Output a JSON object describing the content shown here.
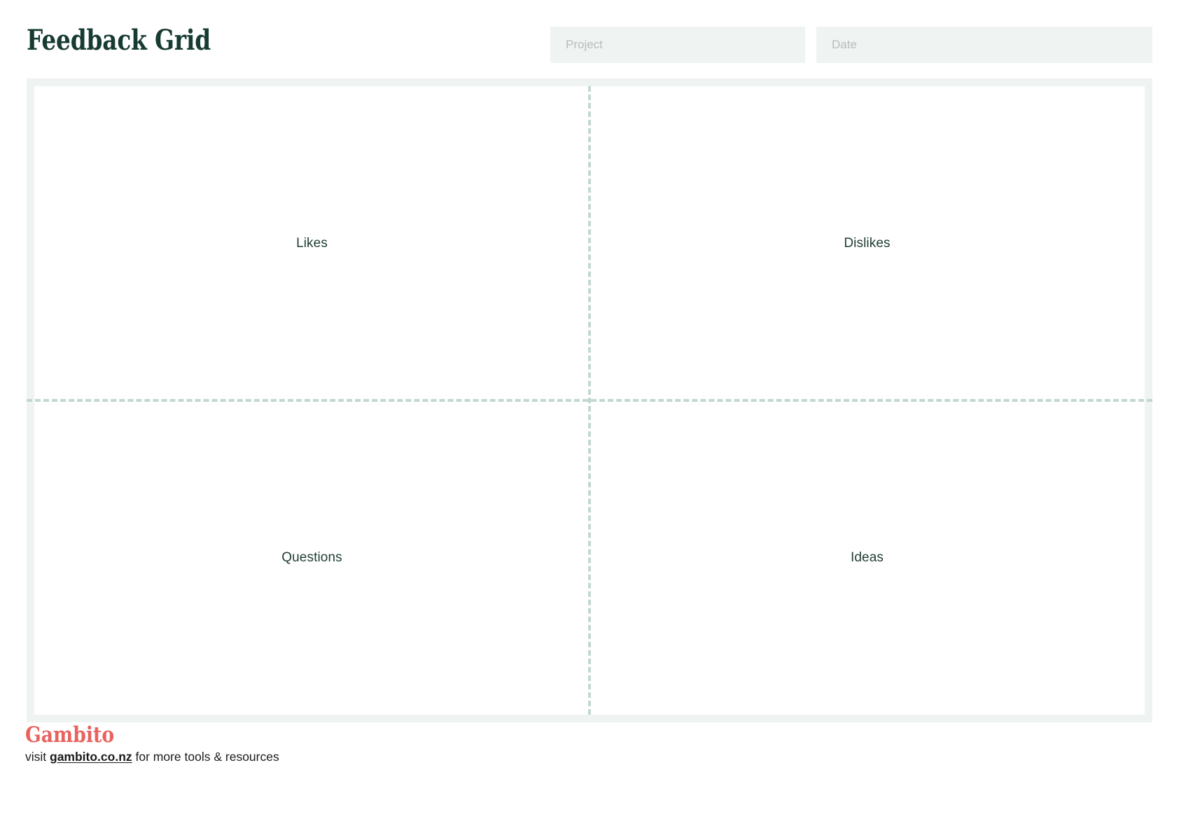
{
  "header": {
    "title": "Feedback Grid",
    "title_color": "#173b33",
    "fields": [
      {
        "name": "project",
        "placeholder": "Project",
        "value": ""
      },
      {
        "name": "date",
        "placeholder": "Date",
        "value": ""
      }
    ],
    "field_bg": "#eff4f2",
    "placeholder_color": "#b7bdbb"
  },
  "grid": {
    "frame_border_color": "#eff4f2",
    "divider_color": "#c2d8ce",
    "divider_style": "dashed",
    "quadrants": [
      {
        "id": "likes",
        "label": "Likes",
        "position": "top-left",
        "content": ""
      },
      {
        "id": "dislikes",
        "label": "Dislikes",
        "position": "top-right",
        "content": ""
      },
      {
        "id": "questions",
        "label": "Questions",
        "position": "bottom-left",
        "content": ""
      },
      {
        "id": "ideas",
        "label": "Ideas",
        "position": "bottom-right",
        "content": ""
      }
    ]
  },
  "footer": {
    "brand": "Gambito",
    "brand_color": "#e8635f",
    "text_before": "visit ",
    "link": "gambito.co.nz",
    "text_after": " for more tools & resources"
  }
}
